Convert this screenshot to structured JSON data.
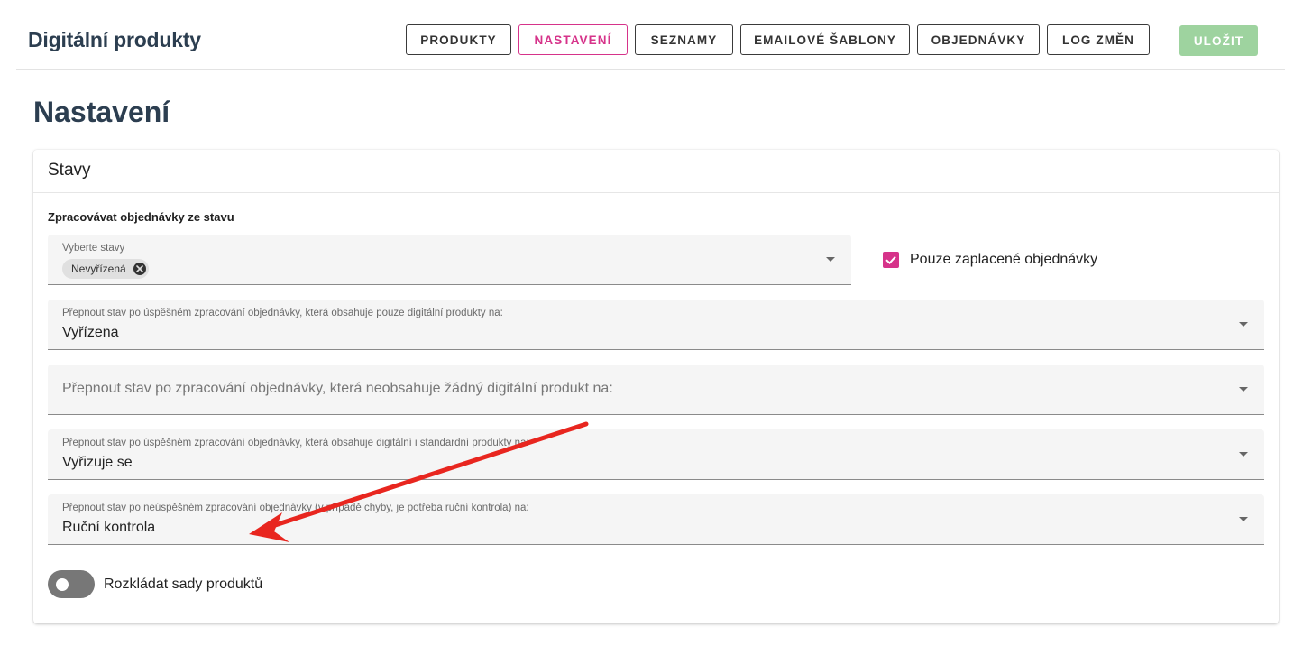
{
  "header": {
    "app_title": "Digitální produkty",
    "nav": [
      "PRODUKTY",
      "NASTAVENÍ",
      "SEZNAMY",
      "EMAILOVÉ ŠABLONY",
      "OBJEDNÁVKY",
      "LOG ZMĚN"
    ],
    "active_tab": "NASTAVENÍ",
    "save_label": "ULOŽIT"
  },
  "page": {
    "title": "Nastavení"
  },
  "card": {
    "title": "Stavy",
    "section_label": "Zpracovávat objednávky ze stavu",
    "status_select": {
      "label": "Vyberte stavy",
      "chip": "Nevyřízená"
    },
    "paid_only": {
      "label": "Pouze zaplacené objednávky",
      "checked": true
    },
    "fields": [
      {
        "label": "Přepnout stav po úspěšném zpracování objednávky, která obsahuje pouze digitální produkty na:",
        "value": "Vyřízena"
      },
      {
        "placeholder": "Přepnout stav po zpracování objednávky, která neobsahuje žádný digitální produkt na:"
      },
      {
        "label": "Přepnout stav po úspěšném zpracování objednávky, která obsahuje digitální i standardní produkty na:",
        "value": "Vyřizuje se"
      },
      {
        "label": "Přepnout stav po neúspěšném zpracování objednávky (v případě chyby, je potřeba ruční kontrola) na:",
        "value": "Ruční kontrola"
      }
    ],
    "split_sets": {
      "label": "Rozkládat sady produktů",
      "enabled": false
    }
  },
  "colors": {
    "accent": "#d6338a",
    "save_disabled": "#9ed39f",
    "annotation_arrow": "#e8261f"
  }
}
